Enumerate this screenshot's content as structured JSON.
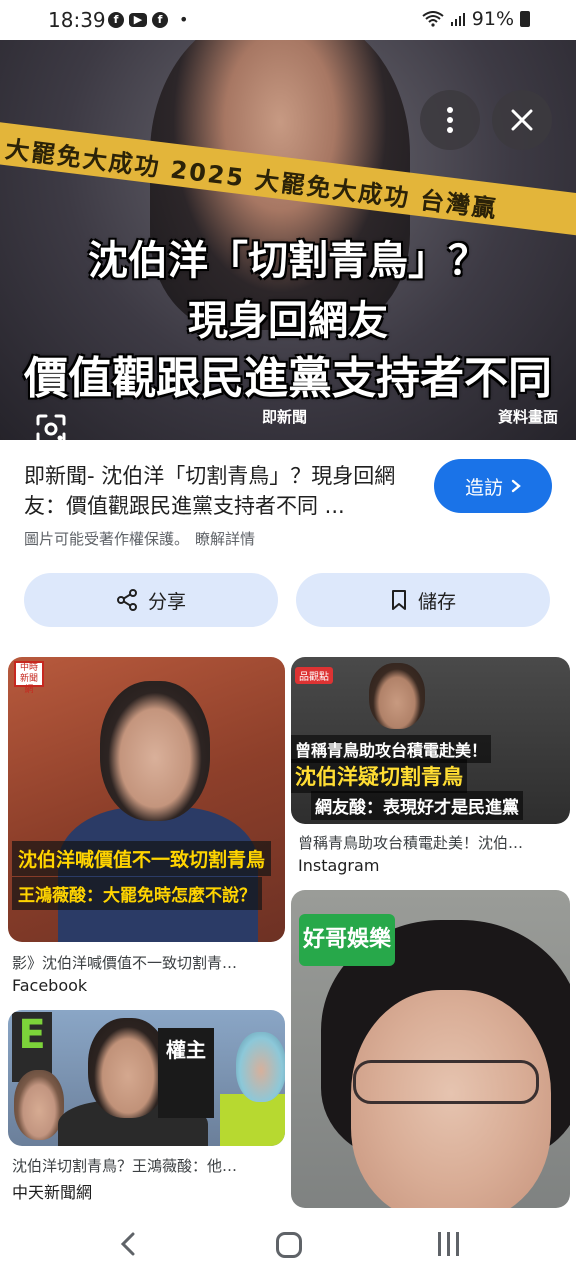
{
  "status_bar": {
    "time": "18:39",
    "apps": [
      "f",
      "▶",
      "f"
    ],
    "dot": "•",
    "battery": "91%"
  },
  "hero": {
    "tape_text": "大罷免大成功 2025 大罷免大成功 台灣贏",
    "headline_1": "沈伯洋「切割青鳥」？",
    "headline_2": "現身回網友",
    "headline_3": "價值觀跟民進黨支持者不同",
    "credit_left": "即新聞",
    "credit_right": "資料畫面"
  },
  "result": {
    "title": "即新聞- 沈伯洋「切割青鳥」？現身回網友：價值觀跟民進黨支持者不同 ...",
    "visit_label": "造訪",
    "copyright_text": "圖片可能受著作權保護。",
    "learn_more": "瞭解詳情",
    "share_label": "分享",
    "save_label": "儲存"
  },
  "cards": [
    {
      "badge": "中時新聞網",
      "overlay_1": "沈伯洋喊價值不一致切割青鳥",
      "overlay_2": "王鴻薇酸：大罷免時怎麼不說？",
      "caption": "影》沈伯洋喊價值不一致切割青…",
      "source": "Facebook"
    },
    {
      "logo": "品觀點",
      "overlay_1": "曾稱青鳥助攻台積電赴美！",
      "overlay_2": "沈伯洋疑切割青鳥",
      "overlay_3": "網友酸：表現好才是民進黨",
      "caption": "曾稱青鳥助攻台積電赴美！沈伯…",
      "source": "Instagram"
    },
    {
      "sign": "權主",
      "green_letter": "E",
      "caption": "沈伯洋切割青鳥？王鴻薇酸：他…",
      "source": "中天新聞網"
    },
    {
      "logo": "好哥娛樂"
    }
  ],
  "icons": {
    "more": "kebab-icon",
    "close": "close-icon",
    "lens": "lens-icon",
    "share": "share-icon",
    "bookmark": "bookmark-icon",
    "chevron": "chevron-right-icon"
  },
  "colors": {
    "visit_button": "#1a73e8",
    "action_button": "#dde8fb"
  }
}
